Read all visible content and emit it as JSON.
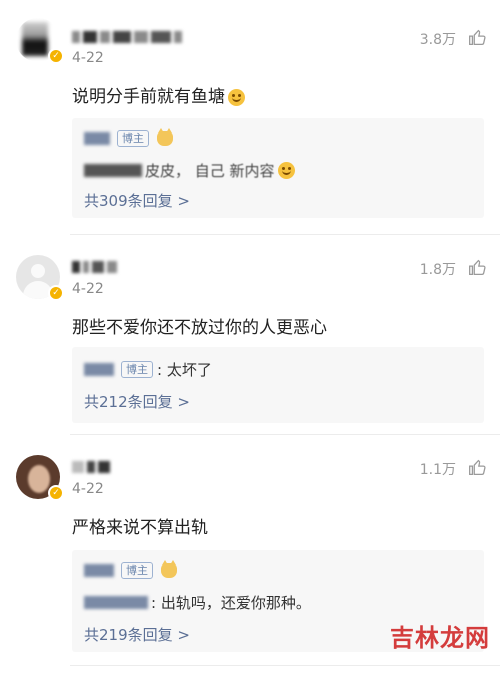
{
  "comments": [
    {
      "date": "4-22",
      "likes": "3.8万",
      "text": "说明分手前就有鱼塘",
      "reply_tag": "博主",
      "reply_text_visible": "皮皮， 自己   新内容",
      "reply_more": "共309条回复 >"
    },
    {
      "date": "4-22",
      "likes": "1.8万",
      "text": "那些不爱你还不放过你的人更恶心",
      "reply_tag": "博主",
      "reply_text_visible": ": 太坏了",
      "reply_more": "共212条回复 >"
    },
    {
      "date": "4-22",
      "likes": "1.1万",
      "text": "严格来说不算出轨",
      "reply_tag": "博主",
      "reply_text_visible": ": 出轨吗，还爱你那种。",
      "reply_more": "共219条回复 >"
    }
  ],
  "watermark": "吉林龙网",
  "colors": {
    "accent_link": "#5b6f95",
    "badge": "#f5b300",
    "watermark": "#d43c3c"
  }
}
